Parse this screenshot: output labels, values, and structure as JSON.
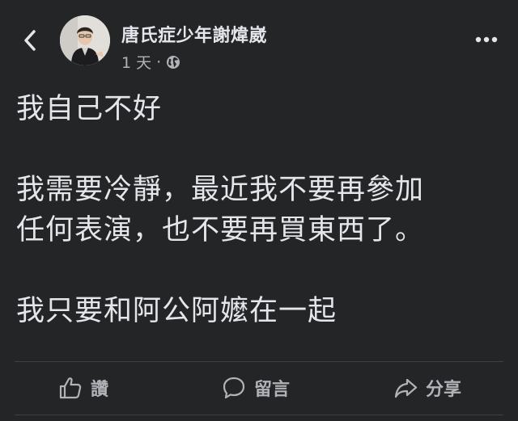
{
  "post": {
    "author": "唐氏症少年謝煒崴",
    "time": "1 天",
    "separator": "·",
    "audience_icon": "globe-icon",
    "paragraphs": [
      [
        "我自己不好"
      ],
      [
        "我需要冷靜，最近我不要再參加",
        "任何表演，也不要再買東西了。"
      ],
      [
        "我只要和阿公阿嬤在一起"
      ]
    ]
  },
  "actions": {
    "like_label": "讚",
    "comment_label": "留言",
    "share_label": "分享"
  },
  "colors": {
    "background": "#242526",
    "primary_text": "#e4e6eb",
    "secondary_text": "#b0b3b8",
    "divider": "#3e4042"
  }
}
